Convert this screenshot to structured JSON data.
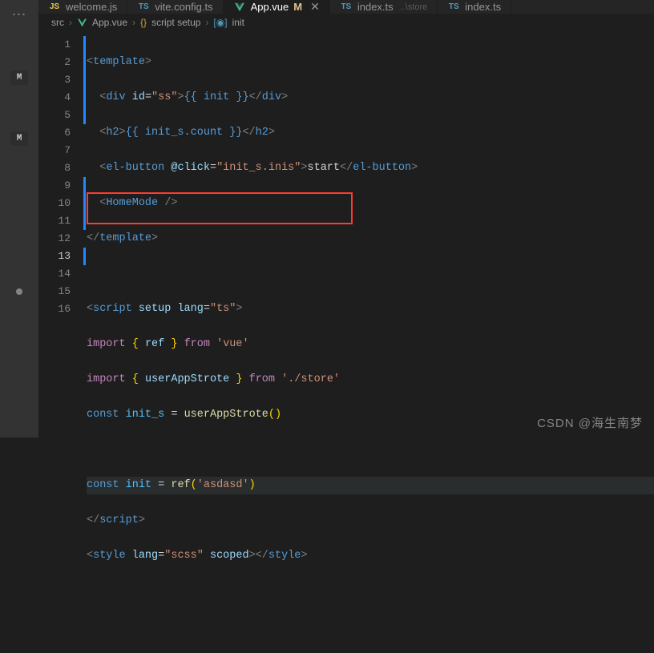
{
  "activity": {
    "m1": "M",
    "m2": "M"
  },
  "tabs": [
    {
      "icon_color": "#e6c84f",
      "icon_text": "JS",
      "label": "welcome.js"
    },
    {
      "icon_color": "#519aba",
      "icon_text": "TS",
      "label": "vite.config.ts"
    },
    {
      "vue": true,
      "label": "App.vue",
      "marker": "M",
      "close": "✕",
      "active": true
    },
    {
      "icon_color": "#519aba",
      "icon_text": "TS",
      "label": "index.ts",
      "suffix": "..\\store"
    },
    {
      "icon_color": "#519aba",
      "icon_text": "TS",
      "label": "index.ts"
    }
  ],
  "breadcrumbs": {
    "items": [
      "src",
      "App.vue",
      "script setup",
      "init"
    ],
    "sep": "›"
  },
  "lines": [
    "1",
    "2",
    "3",
    "4",
    "5",
    "6",
    "7",
    "8",
    "9",
    "10",
    "11",
    "12",
    "13",
    "14",
    "15",
    "16"
  ],
  "code": {
    "l1": {
      "template": "template"
    },
    "l2": {
      "div": "div",
      "id_attr": "id",
      "id_val": "\"ss\"",
      "mustache": "{{ init }}"
    },
    "l3": {
      "h2": "h2",
      "mustache": "{{ init_s.count }}"
    },
    "l4": {
      "elbtn": "el-button",
      "at": "@click",
      "val": "\"init_s.inis\"",
      "text": "start"
    },
    "l5": {
      "home": "HomeMode"
    },
    "l6": {
      "template": "template"
    },
    "l8": {
      "script": "script",
      "setup": "setup",
      "lang": "lang",
      "ts": "\"ts\""
    },
    "l9": {
      "import": "import",
      "ref": "ref",
      "from": "from",
      "vue": "'vue'"
    },
    "l10": {
      "import": "import",
      "uas": "userAppStrote",
      "from": "from",
      "store": "'./store'"
    },
    "l11": {
      "const": "const",
      "var": "init_s",
      "fn": "userAppStrote"
    },
    "l13": {
      "const": "const",
      "var": "init",
      "ref": "ref",
      "val": "'asdasd'"
    },
    "l14": {
      "script": "script"
    },
    "l15": {
      "style": "style",
      "lang": "lang",
      "scss": "\"scss\"",
      "scoped": "scoped"
    }
  },
  "watermark": "CSDN @海生南梦"
}
